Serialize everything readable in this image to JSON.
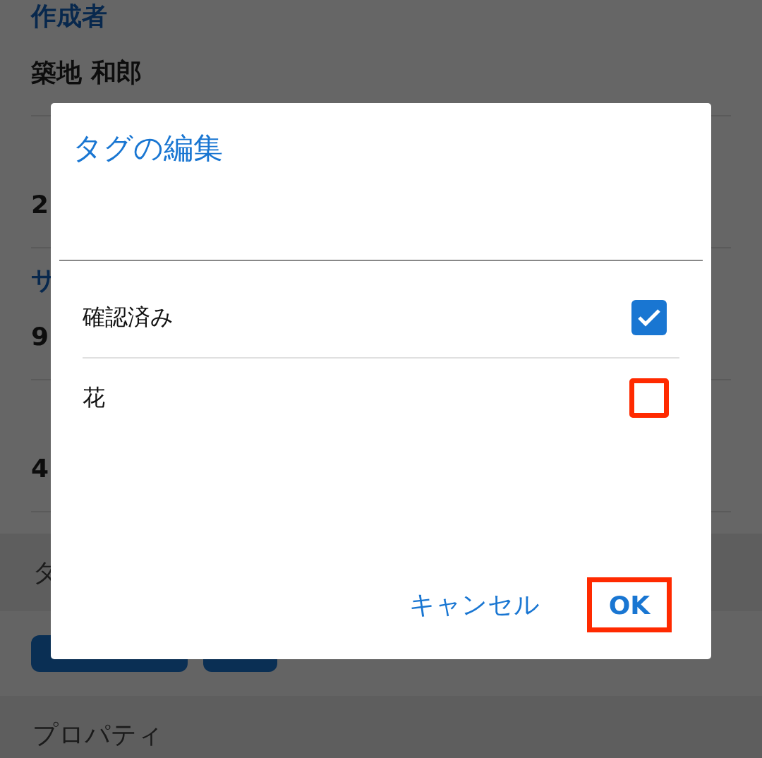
{
  "background": {
    "fields": [
      {
        "label": "作成者",
        "value": "築地 和郎"
      },
      {
        "value": "2"
      },
      {
        "label": "サ",
        "value": "9"
      },
      {
        "value": "4"
      }
    ],
    "sections": [
      {
        "title": "タ",
        "kind": "tags"
      },
      {
        "title": "プロパティ",
        "kind": "plain"
      }
    ]
  },
  "dialog": {
    "title": "タグの編集",
    "items": [
      {
        "label": "確認済み",
        "checked": true,
        "highlighted": false
      },
      {
        "label": "花",
        "checked": false,
        "highlighted": true
      }
    ],
    "buttons": [
      {
        "label": "キャンセル",
        "primary": false,
        "highlighted": false
      },
      {
        "label": "OK",
        "primary": true,
        "highlighted": true
      }
    ]
  }
}
